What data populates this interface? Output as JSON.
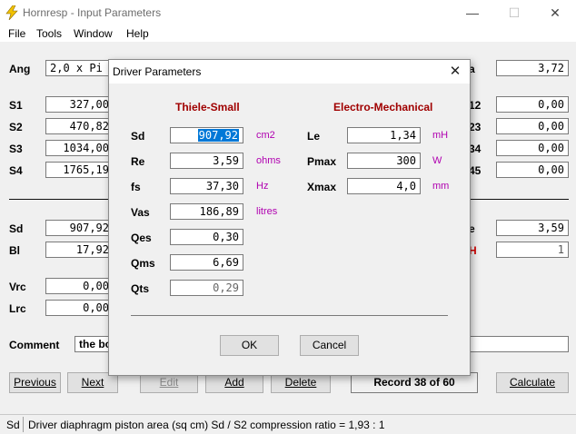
{
  "window": {
    "title": "Hornresp - Input Parameters",
    "minimize": "—",
    "maximize": "☐",
    "close": "✕"
  },
  "menu": [
    "File",
    "Tools",
    "Window",
    "Help"
  ],
  "main": {
    "ang": {
      "label": "Ang",
      "value": "2,0 x Pi"
    },
    "right_top": {
      "label": "a",
      "value": "3,72"
    },
    "s_rows": [
      {
        "label": "S1",
        "value": "327,00"
      },
      {
        "label": "S2",
        "value": "470,82"
      },
      {
        "label": "S3",
        "value": "1034,00"
      },
      {
        "label": "S4",
        "value": "1765,19"
      }
    ],
    "right_rows": [
      {
        "label": "12",
        "value": "0,00"
      },
      {
        "label": "23",
        "value": "0,00"
      },
      {
        "label": "34",
        "value": "0,00"
      },
      {
        "label": "45",
        "value": "0,00"
      }
    ],
    "driver_rows": [
      {
        "label": "Sd",
        "value": "907,92"
      },
      {
        "label": "Bl",
        "value": "17,92"
      }
    ],
    "driver_right": [
      {
        "label": "e",
        "value": "3,59"
      },
      {
        "label": "H",
        "value": "1"
      }
    ],
    "vrc": {
      "label": "Vrc",
      "value": "0,00"
    },
    "lrc": {
      "label": "Lrc",
      "value": "0,00"
    },
    "comment": {
      "label": "Comment",
      "value": "the bo"
    }
  },
  "buttons": {
    "previous": "Previous",
    "next": "Next",
    "edit": "Edit",
    "add": "Add",
    "delete": "Delete",
    "record": "Record 38 of 60",
    "calculate": "Calculate"
  },
  "status": {
    "code": "Sd",
    "text": "Driver diaphragm piston area (sq cm)  Sd / S2 compression ratio = 1,93 : 1"
  },
  "dialog": {
    "title": "Driver Parameters",
    "close": "✕",
    "left_header": "Thiele-Small",
    "right_header": "Electro-Mechanical",
    "ts": [
      {
        "label": "Sd",
        "value": "907,92",
        "unit": "cm2"
      },
      {
        "label": "Re",
        "value": "3,59",
        "unit": "ohms"
      },
      {
        "label": "fs",
        "value": "37,30",
        "unit": "Hz"
      },
      {
        "label": "Vas",
        "value": "186,89",
        "unit": "litres"
      },
      {
        "label": "Qes",
        "value": "0,30",
        "unit": ""
      },
      {
        "label": "Qms",
        "value": "6,69",
        "unit": ""
      },
      {
        "label": "Qts",
        "value": "0,29",
        "unit": ""
      }
    ],
    "em": [
      {
        "label": "Le",
        "value": "1,34",
        "unit": "mH"
      },
      {
        "label": "Pmax",
        "value": "300",
        "unit": "W"
      },
      {
        "label": "Xmax",
        "value": "4,0",
        "unit": "mm"
      }
    ],
    "ok": "OK",
    "cancel": "Cancel"
  },
  "colors": {
    "section_header": "#a00000",
    "unit": "#b000b0",
    "selection": "#0078d7"
  }
}
